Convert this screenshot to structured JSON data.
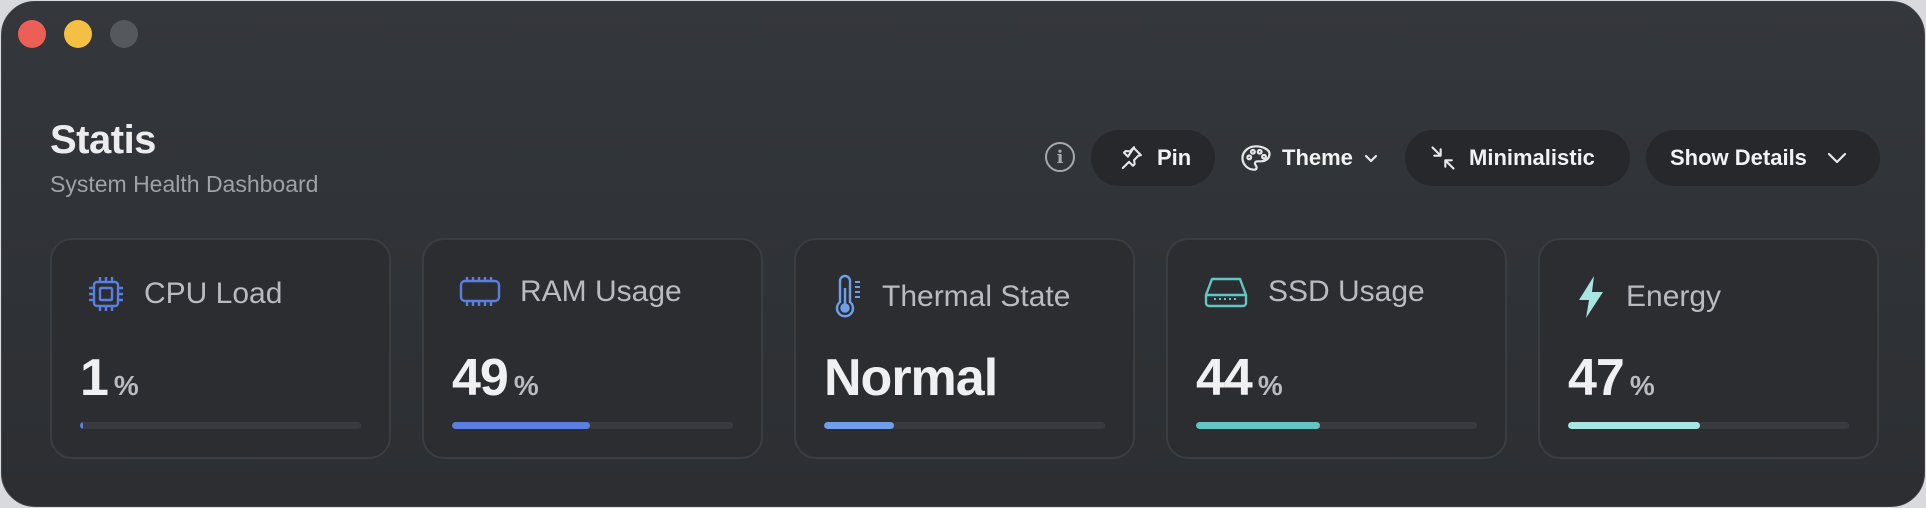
{
  "header": {
    "title": "Statis",
    "subtitle": "System Health Dashboard"
  },
  "toolbar": {
    "info_icon": "info-circle-icon",
    "info_glyph": "i",
    "pin_label": "Pin",
    "theme_label": "Theme",
    "minimalistic_label": "Minimalistic",
    "details_label": "Show Details"
  },
  "cards": [
    {
      "label": "CPU Load",
      "value": "1",
      "unit": "%",
      "progress": 0.01,
      "icon": "cpu-chip-icon",
      "color": "#5b7fe0"
    },
    {
      "label": "RAM Usage",
      "value": "49",
      "unit": "%",
      "progress": 0.49,
      "icon": "memory-module-icon",
      "color": "#5b7fe0"
    },
    {
      "label": "Thermal State",
      "value": "Normal",
      "unit": "",
      "progress": 0.25,
      "icon": "thermometer-icon",
      "color": "#6e9fe8"
    },
    {
      "label": "SSD Usage",
      "value": "44",
      "unit": "%",
      "progress": 0.44,
      "icon": "drive-icon",
      "color": "#63c6c2"
    },
    {
      "label": "Energy",
      "value": "47",
      "unit": "%",
      "progress": 0.47,
      "icon": "lightning-bolt-icon",
      "color": "#a8e6e3"
    }
  ]
}
